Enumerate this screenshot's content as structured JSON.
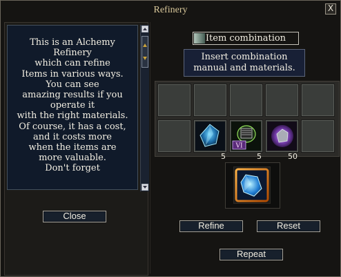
{
  "window": {
    "title": "Refinery",
    "close_glyph": "X"
  },
  "left_panel": {
    "lines": [
      "This is an Alchemy",
      "Refinery",
      "which can refine",
      "Items in various ways.",
      "You can see",
      "amazing results if you",
      "operate it",
      "with the right materials.",
      "Of course, it has a cost,",
      "and it costs more",
      "when the items are",
      "more valuable.",
      "Don't forget"
    ],
    "close_label": "Close"
  },
  "right_panel": {
    "item_combination_label": "Item combination",
    "instructions_line1": "Insert combination",
    "instructions_line2": "manual and materials.",
    "slots": [
      {
        "item": "",
        "count": ""
      },
      {
        "item": "",
        "count": ""
      },
      {
        "item": "",
        "count": ""
      },
      {
        "item": "",
        "count": ""
      },
      {
        "item": "",
        "count": ""
      },
      {
        "item": "",
        "count": ""
      },
      {
        "item": "blue-crystal-icon",
        "count": "5"
      },
      {
        "item": "green-vial-icon",
        "count": "5"
      },
      {
        "item": "purple-ore-icon",
        "count": "50"
      },
      {
        "item": "",
        "count": ""
      }
    ],
    "result_item": "blue-crystal-result-icon",
    "refine_label": "Refine",
    "reset_label": "Reset",
    "repeat_label": "Repeat"
  }
}
